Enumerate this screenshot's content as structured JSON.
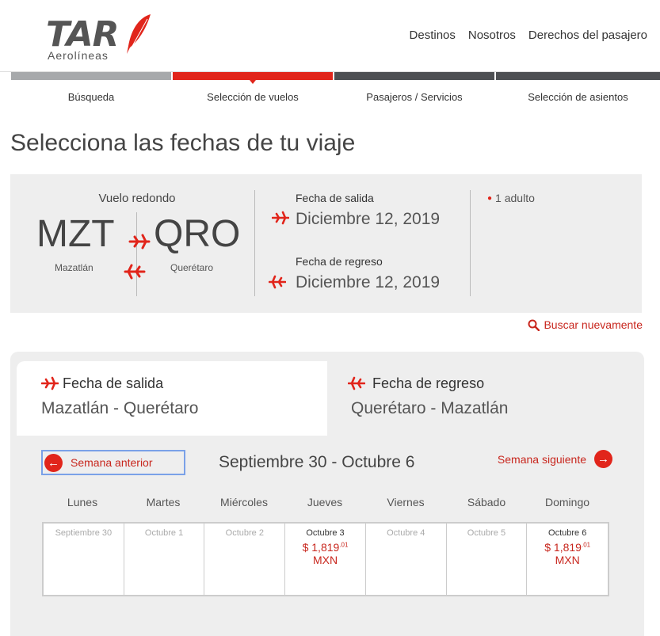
{
  "header": {
    "logo_text": "TAR",
    "logo_sub": "Aerolíneas",
    "nav": [
      "Destinos",
      "Nosotros",
      "Derechos del pasajero"
    ]
  },
  "steps": [
    {
      "label": "Búsqueda",
      "color": "#a7a9ab",
      "active": false
    },
    {
      "label": "Selección de vuelos",
      "color": "#e1251b",
      "active": true
    },
    {
      "label": "Pasajeros / Servicios",
      "color": "#4d4f52",
      "active": false
    },
    {
      "label": "Selección de asientos",
      "color": "#4d4f52",
      "active": false
    }
  ],
  "page_title": "Selecciona las fechas de tu viaje",
  "summary": {
    "trip_type": "Vuelo redondo",
    "origin_code": "MZT",
    "origin_city": "Mazatlán",
    "dest_code": "QRO",
    "dest_city": "Querétaro",
    "departure_label": "Fecha de salida",
    "departure_date": "Diciembre 12, 2019",
    "return_label": "Fecha de regreso",
    "return_date": "Diciembre 12, 2019",
    "passengers": "1 adulto"
  },
  "search_again": "Buscar nuevamente",
  "tabs": {
    "outbound": {
      "title": "Fecha de salida",
      "route": "Mazatlán - Querétaro"
    },
    "return": {
      "title": "Fecha de regreso",
      "route": "Querétaro - Mazatlán"
    }
  },
  "calendar": {
    "prev_label": "Semana anterior",
    "next_label": "Semana siguiente",
    "range": "Septiembre 30 - Octubre 6",
    "days": [
      "Lunes",
      "Martes",
      "Miércoles",
      "Jueves",
      "Viernes",
      "Sábado",
      "Domingo"
    ],
    "cells": [
      {
        "date": "Septiembre 30",
        "price": "",
        "cents": "",
        "currency": ""
      },
      {
        "date": "Octubre 1",
        "price": "",
        "cents": "",
        "currency": ""
      },
      {
        "date": "Octubre 2",
        "price": "",
        "cents": "",
        "currency": ""
      },
      {
        "date": "Octubre 3",
        "price": "$ 1,819",
        "cents": ".01",
        "currency": "MXN"
      },
      {
        "date": "Octubre 4",
        "price": "",
        "cents": "",
        "currency": ""
      },
      {
        "date": "Octubre 5",
        "price": "",
        "cents": "",
        "currency": ""
      },
      {
        "date": "Octubre 6",
        "price": "$ 1,819",
        "cents": ".01",
        "currency": "MXN"
      }
    ]
  },
  "colors": {
    "accent": "#e1251b",
    "link": "#c8261d",
    "panel": "#eeeeee"
  }
}
